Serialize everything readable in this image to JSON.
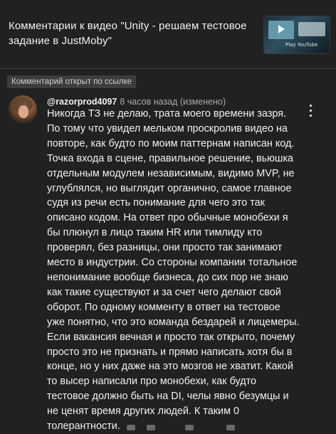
{
  "header": {
    "video_title_line1": "Комментарии к видео \"Unity - решаем тестовое",
    "video_title_line2": "задание в JustMoby\"",
    "thumbnail_label": "Play YouTube"
  },
  "badge": {
    "label": "Комментарий открыт по ссылке"
  },
  "comment": {
    "author": "@razorprod4097",
    "time": "8 часов назад (изменено)",
    "lines": [
      "Никогда ТЗ не делаю, трата моего времени зазря.",
      "По тому что увидел мельком проскролив видео на",
      "повторе, как будто по моим паттернам написан код.",
      "Точка входа в сцене, правильное решение, вьюшка",
      "отдельным модулем независимым, видимо MVP, не",
      "углублялся, но выглядит органично, самое главное",
      "судя из речи есть понимание для чего это так",
      "описано кодом. На ответ про обычные монобехи я",
      "бы плюнул в лицо таким HR или тимлиду кто",
      "проверял, без разницы, они просто так занимают",
      "место в индустрии. Со стороны компании тотальное",
      "непонимание вообще бизнеса, до сих пор не знаю",
      "как такие существуют и за счет чего делают свой",
      "оборот. По одному комменту в ответ на тестовое",
      "уже понятно, что это команда бездарей и лицемеры.",
      "Если вакансия вечная и просто так открыто, почему",
      "просто это не признать и прямо написать хотя бы в",
      "конце, но у них даже на это мозгов не хватит. Какой",
      "то высер написали про монобехи, как будто",
      "тестовое должно быть на DI, челы явно безумцы и",
      "не ценят время других людей. К таким 0",
      "толерантности."
    ]
  },
  "colors": {
    "background": "#212121",
    "text": "#f1f1f1",
    "secondary_text": "#aaaaaa",
    "badge_bg": "#3d3d3d"
  }
}
